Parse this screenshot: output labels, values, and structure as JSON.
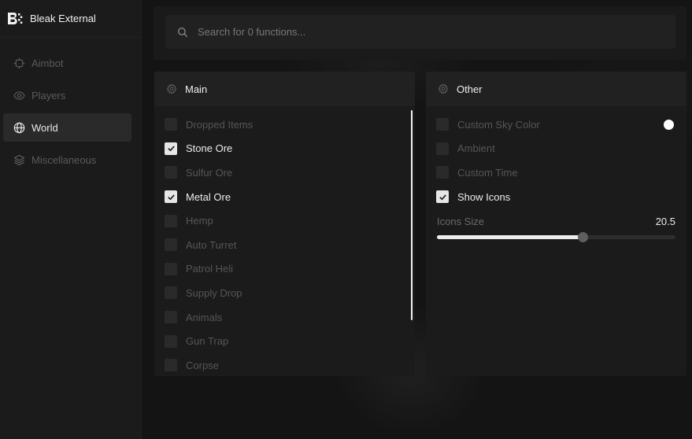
{
  "app": {
    "title": "Bleak External",
    "logo_glyph": "B"
  },
  "sidebar": {
    "items": [
      {
        "label": "Aimbot",
        "icon": "crosshair-icon",
        "active": false
      },
      {
        "label": "Players",
        "icon": "eye-icon",
        "active": false
      },
      {
        "label": "World",
        "icon": "globe-icon",
        "active": true
      },
      {
        "label": "Miscellaneous",
        "icon": "layers-icon",
        "active": false
      }
    ]
  },
  "search": {
    "placeholder": "Search for 0 functions...",
    "value": "",
    "icon": "search-icon"
  },
  "panels": {
    "main": {
      "title": "Main",
      "icon": "gear-icon",
      "options": [
        {
          "label": "Dropped Items",
          "checked": false
        },
        {
          "label": "Stone Ore",
          "checked": true
        },
        {
          "label": "Sulfur Ore",
          "checked": false
        },
        {
          "label": "Metal Ore",
          "checked": true
        },
        {
          "label": "Hemp",
          "checked": false
        },
        {
          "label": "Auto Turret",
          "checked": false
        },
        {
          "label": "Patrol Heli",
          "checked": false
        },
        {
          "label": "Supply Drop",
          "checked": false
        },
        {
          "label": "Animals",
          "checked": false
        },
        {
          "label": "Gun Trap",
          "checked": false
        },
        {
          "label": "Corpse",
          "checked": false
        }
      ]
    },
    "other": {
      "title": "Other",
      "icon": "gear-icon",
      "options": [
        {
          "label": "Custom Sky Color",
          "checked": false
        },
        {
          "label": "Ambient",
          "checked": false
        },
        {
          "label": "Custom Time",
          "checked": false
        },
        {
          "label": "Show Icons",
          "checked": true
        }
      ],
      "sky_color": "#ffffff",
      "slider": {
        "label": "Icons Size",
        "value": "20.5",
        "fill_fraction": 0.615
      }
    }
  },
  "colors": {
    "background": "#141414",
    "sidebar": "#1b1b1b",
    "panel": "#1b1b1b",
    "panel_header": "#212121",
    "text_active": "#ececec",
    "text_muted": "#565656",
    "accent": "#e6e6e6"
  }
}
